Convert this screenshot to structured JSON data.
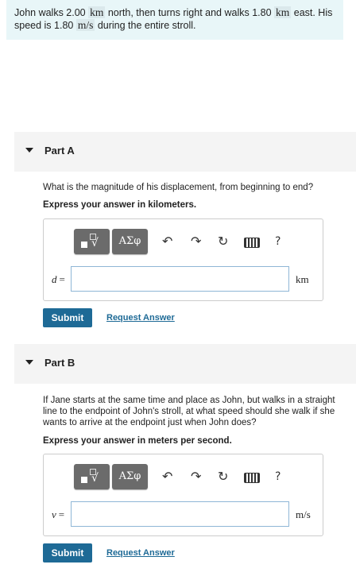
{
  "problem": {
    "part1": "John walks 2.00 ",
    "unit1": "km",
    "part2": " north, then turns right and walks 1.80 ",
    "unit2": "km",
    "part3": " east. His speed is 1.80 ",
    "unit3": "m/s",
    "part4": " during the entire stroll."
  },
  "toolbar": {
    "template_icon": "template-radical-icon",
    "symbols_label": "ΑΣφ",
    "undo_icon": "undo-icon",
    "redo_icon": "redo-icon",
    "reset_icon": "reset-icon",
    "keyboard_icon": "keyboard-icon",
    "help_label": "?"
  },
  "partA": {
    "title": "Part A",
    "question": "What is the magnitude of his displacement, from beginning to end?",
    "instruction": "Express your answer in kilometers.",
    "variable": "d",
    "equals": "=",
    "value": "",
    "units": "km",
    "submit": "Submit",
    "request": "Request Answer"
  },
  "partB": {
    "title": "Part B",
    "question": "If Jane starts at the same time and place as John, but walks in a straight line to the endpoint of John's stroll, at what speed should she walk if she wants to arrive at the endpoint just when John does?",
    "instruction": "Express your answer in meters per second.",
    "variable": "v",
    "equals": "=",
    "value": "",
    "units": "m/s",
    "submit": "Submit",
    "request": "Request Answer"
  },
  "colors": {
    "problem_bg": "#e8f6f8",
    "submit_bg": "#1e6a96",
    "link": "#1e6a96"
  }
}
